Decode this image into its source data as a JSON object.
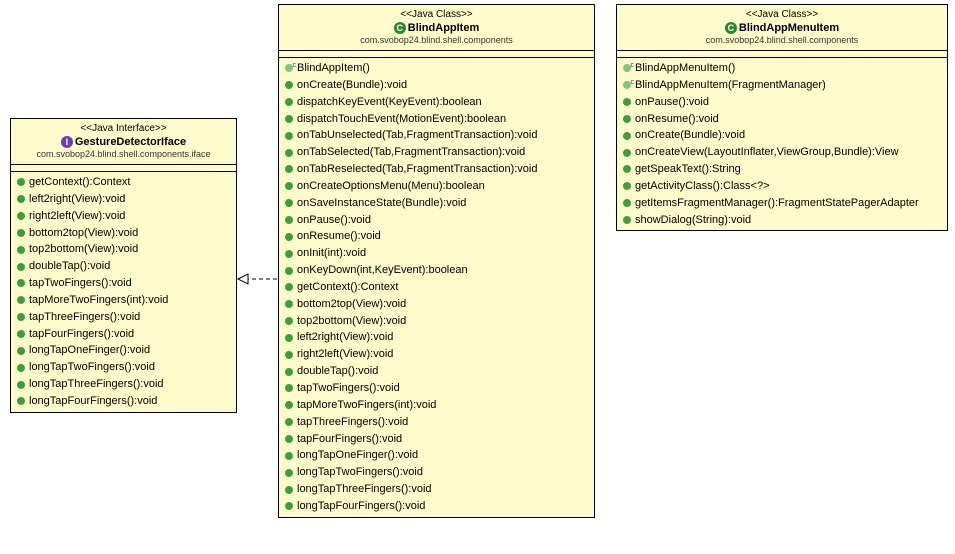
{
  "classes": {
    "iface": {
      "stereotype": "<<Java Interface>>",
      "name": "GestureDetectorIface",
      "type_letter": "I",
      "package": "com.svobop24.blind.shell.components.iface",
      "members": [
        {
          "vis": "public",
          "sig": "getContext():Context"
        },
        {
          "vis": "public",
          "sig": "left2right(View):void"
        },
        {
          "vis": "public",
          "sig": "right2left(View):void"
        },
        {
          "vis": "public",
          "sig": "bottom2top(View):void"
        },
        {
          "vis": "public",
          "sig": "top2bottom(View):void"
        },
        {
          "vis": "public",
          "sig": "doubleTap():void"
        },
        {
          "vis": "public",
          "sig": "tapTwoFingers():void"
        },
        {
          "vis": "public",
          "sig": "tapMoreTwoFingers(int):void"
        },
        {
          "vis": "public",
          "sig": "tapThreeFingers():void"
        },
        {
          "vis": "public",
          "sig": "tapFourFingers():void"
        },
        {
          "vis": "public",
          "sig": "longTapOneFinger():void"
        },
        {
          "vis": "public",
          "sig": "longTapTwoFingers():void"
        },
        {
          "vis": "public",
          "sig": "longTapThreeFingers():void"
        },
        {
          "vis": "public",
          "sig": "longTapFourFingers():void"
        }
      ]
    },
    "blindappitem": {
      "stereotype": "<<Java Class>>",
      "name": "BlindAppItem",
      "type_letter": "C",
      "package": "com.svobop24.blind.shell.components",
      "members": [
        {
          "vis": "constructor",
          "sig": "BlindAppItem()"
        },
        {
          "vis": "public",
          "sig": "onCreate(Bundle):void"
        },
        {
          "vis": "public",
          "sig": "dispatchKeyEvent(KeyEvent):boolean"
        },
        {
          "vis": "public",
          "sig": "dispatchTouchEvent(MotionEvent):boolean"
        },
        {
          "vis": "public",
          "sig": "onTabUnselected(Tab,FragmentTransaction):void"
        },
        {
          "vis": "public",
          "sig": "onTabSelected(Tab,FragmentTransaction):void"
        },
        {
          "vis": "public",
          "sig": "onTabReselected(Tab,FragmentTransaction):void"
        },
        {
          "vis": "public",
          "sig": "onCreateOptionsMenu(Menu):boolean"
        },
        {
          "vis": "public",
          "sig": "onSaveInstanceState(Bundle):void"
        },
        {
          "vis": "public",
          "sig": "onPause():void"
        },
        {
          "vis": "public",
          "sig": "onResume():void"
        },
        {
          "vis": "public",
          "sig": "onInit(int):void"
        },
        {
          "vis": "public",
          "sig": "onKeyDown(int,KeyEvent):boolean"
        },
        {
          "vis": "public",
          "sig": "getContext():Context"
        },
        {
          "vis": "public",
          "sig": "bottom2top(View):void"
        },
        {
          "vis": "public",
          "sig": "top2bottom(View):void"
        },
        {
          "vis": "public",
          "sig": "left2right(View):void"
        },
        {
          "vis": "public",
          "sig": "right2left(View):void"
        },
        {
          "vis": "public",
          "sig": "doubleTap():void"
        },
        {
          "vis": "public",
          "sig": "tapTwoFingers():void"
        },
        {
          "vis": "public",
          "sig": "tapMoreTwoFingers(int):void"
        },
        {
          "vis": "public",
          "sig": "tapThreeFingers():void"
        },
        {
          "vis": "public",
          "sig": "tapFourFingers():void"
        },
        {
          "vis": "public",
          "sig": "longTapOneFinger():void"
        },
        {
          "vis": "public",
          "sig": "longTapTwoFingers():void"
        },
        {
          "vis": "public",
          "sig": "longTapThreeFingers():void"
        },
        {
          "vis": "public",
          "sig": "longTapFourFingers():void"
        }
      ]
    },
    "blindappmenuitem": {
      "stereotype": "<<Java Class>>",
      "name": "BlindAppMenuItem",
      "type_letter": "C",
      "package": "com.svobop24.blind.shell.components",
      "members": [
        {
          "vis": "constructor",
          "sig": "BlindAppMenuItem()"
        },
        {
          "vis": "constructor",
          "sig": "BlindAppMenuItem(FragmentManager)"
        },
        {
          "vis": "public",
          "sig": "onPause():void"
        },
        {
          "vis": "public",
          "sig": "onResume():void"
        },
        {
          "vis": "public",
          "sig": "onCreate(Bundle):void"
        },
        {
          "vis": "public",
          "sig": "onCreateView(LayoutInflater,ViewGroup,Bundle):View"
        },
        {
          "vis": "public",
          "sig": "getSpeakText():String"
        },
        {
          "vis": "public",
          "sig": "getActivityClass():Class<?>"
        },
        {
          "vis": "public",
          "sig": "getItemsFragmentManager():FragmentStatePagerAdapter"
        },
        {
          "vis": "public",
          "sig": "showDialog(String):void"
        }
      ]
    }
  },
  "relationship": "realization",
  "chart_data": {
    "type": "uml-class-diagram",
    "classes": [
      {
        "name": "GestureDetectorIface",
        "kind": "interface",
        "package": "com.svobop24.blind.shell.components.iface"
      },
      {
        "name": "BlindAppItem",
        "kind": "class",
        "package": "com.svobop24.blind.shell.components"
      },
      {
        "name": "BlindAppMenuItem",
        "kind": "class",
        "package": "com.svobop24.blind.shell.components"
      }
    ],
    "relationships": [
      {
        "from": "BlindAppItem",
        "to": "GestureDetectorIface",
        "type": "realization"
      }
    ]
  }
}
